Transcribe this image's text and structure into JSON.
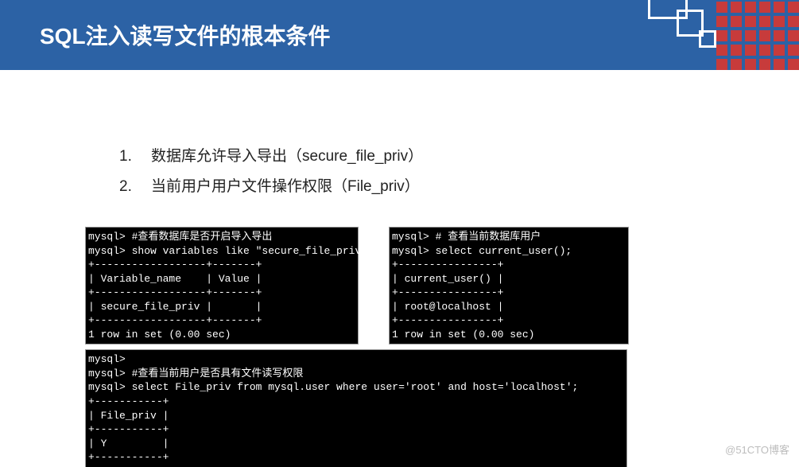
{
  "header": {
    "title": "SQL注入读写文件的根本条件"
  },
  "list": [
    {
      "num": "1.",
      "text": "数据库允许导入导出（secure_file_priv）"
    },
    {
      "num": "2.",
      "text": "当前用户用户文件操作权限（File_priv）"
    }
  ],
  "terminals": {
    "a": "mysql> #查看数据库是否开启导入导出\nmysql> show variables like \"secure_file_priv\";\n+------------------+-------+\n| Variable_name    | Value |\n+------------------+-------+\n| secure_file_priv |       |\n+------------------+-------+\n1 row in set (0.00 sec)",
    "b": "mysql> # 查看当前数据库用户\nmysql> select current_user();\n+----------------+\n| current_user() |\n+----------------+\n| root@localhost |\n+----------------+\n1 row in set (0.00 sec)",
    "c": "mysql>\nmysql> #查看当前用户是否具有文件读写权限\nmysql> select File_priv from mysql.user where user='root' and host='localhost';\n+-----------+\n| File_priv |\n+-----------+\n| Y         |\n+-----------+"
  },
  "watermark": "@51CTO博客"
}
